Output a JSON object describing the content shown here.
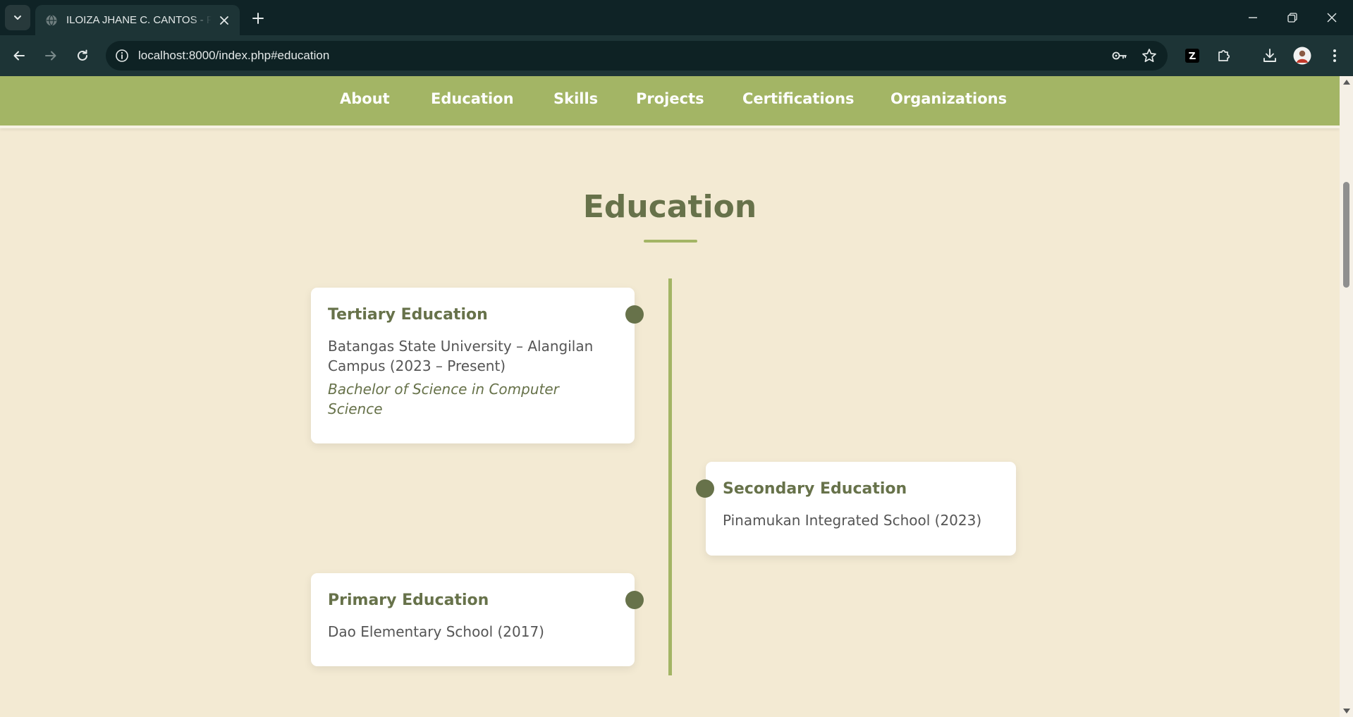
{
  "browser": {
    "tab_title": "ILOIZA JHANE C. CANTOS - Portfolio",
    "url": "localhost:8000/index.php#education"
  },
  "nav": {
    "items": [
      "About",
      "Education",
      "Skills",
      "Projects",
      "Certifications",
      "Organizations"
    ]
  },
  "education": {
    "title": "Education",
    "entries": [
      {
        "heading": "Tertiary Education",
        "school": "Batangas State University – Alangilan Campus (2023 – Present)",
        "degree": "Bachelor of Science in Computer Science"
      },
      {
        "heading": "Secondary Education",
        "school": "Pinamukan Integrated School (2023)"
      },
      {
        "heading": "Primary Education",
        "school": "Dao Elementary School (2017)"
      }
    ]
  },
  "colors": {
    "nav_bg": "#a3b565",
    "page_bg": "#f3ead3",
    "accent_dark": "#67724a",
    "browser_chrome": "#0f2326"
  }
}
